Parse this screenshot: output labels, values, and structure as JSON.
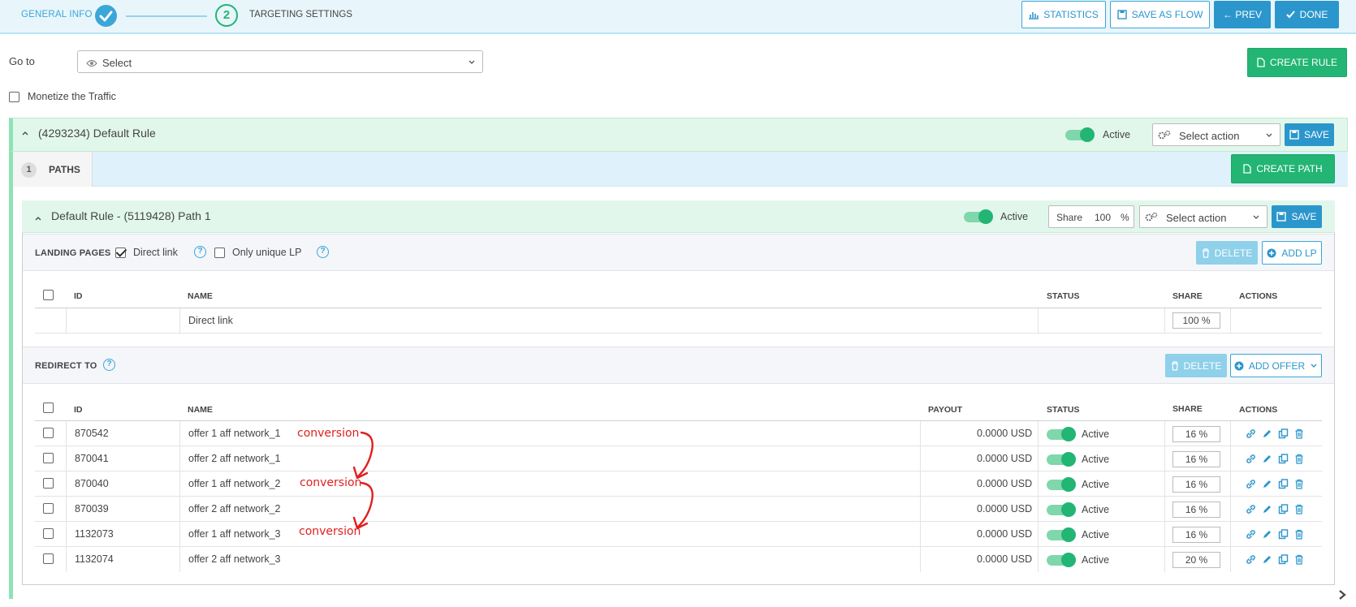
{
  "wizard": {
    "step1_label": "GENERAL INFO",
    "step2_number": "2",
    "step2_label": "TARGETING SETTINGS",
    "buttons": {
      "statistics": "STATISTICS",
      "save_as_flow": "SAVE AS FLOW",
      "prev": "← PREV",
      "done": "DONE"
    }
  },
  "goto": {
    "label": "Go to",
    "select_value": "Select"
  },
  "create_rule_label": "CREATE RULE",
  "monetize_label": "Monetize the Traffic",
  "rule": {
    "title": "(4293234) Default Rule",
    "status_label": "Active",
    "action_placeholder": "Select action",
    "save_label": "SAVE"
  },
  "paths_tab": {
    "count": "1",
    "label": "PATHS",
    "create_path_label": "CREATE PATH"
  },
  "path": {
    "title": "Default Rule - (5119428) Path 1",
    "status_label": "Active",
    "share_label": "Share",
    "share_value": "100",
    "share_unit": "%",
    "action_placeholder": "Select action",
    "save_label": "SAVE"
  },
  "landing_pages": {
    "title": "LANDING PAGES",
    "direct_link_label": "Direct link",
    "only_unique_label": "Only unique LP",
    "delete_label": "DELETE",
    "add_label": "ADD LP",
    "columns": [
      "ID",
      "NAME",
      "STATUS",
      "SHARE",
      "ACTIONS"
    ],
    "rows": [
      {
        "id": "",
        "name": "Direct link",
        "status": "",
        "share": "100 %"
      }
    ]
  },
  "redirect": {
    "title": "REDIRECT TO",
    "delete_label": "DELETE",
    "add_label": "ADD OFFER",
    "columns": [
      "ID",
      "NAME",
      "PAYOUT",
      "STATUS",
      "SHARE",
      "ACTIONS"
    ],
    "rows": [
      {
        "id": "870542",
        "name": "offer 1 aff network_1",
        "payout": "0.0000 USD",
        "status": "Active",
        "share": "16 %"
      },
      {
        "id": "870041",
        "name": "offer 2 aff network_1",
        "payout": "0.0000 USD",
        "status": "Active",
        "share": "16 %"
      },
      {
        "id": "870040",
        "name": "offer 1 aff network_2",
        "payout": "0.0000 USD",
        "status": "Active",
        "share": "16 %"
      },
      {
        "id": "870039",
        "name": "offer 2 aff network_2",
        "payout": "0.0000 USD",
        "status": "Active",
        "share": "16 %"
      },
      {
        "id": "1132073",
        "name": "offer 1 aff network_3",
        "payout": "0.0000 USD",
        "status": "Active",
        "share": "16 %"
      },
      {
        "id": "1132074",
        "name": "offer 2 aff network_3",
        "payout": "0.0000 USD",
        "status": "Active",
        "share": "20 %"
      }
    ],
    "annotations": [
      "conversion",
      "conversion",
      "conversion"
    ]
  },
  "colors": {
    "accent_blue": "#2b96cc",
    "accent_green": "#22b573",
    "annotation_red": "#e0201f"
  }
}
